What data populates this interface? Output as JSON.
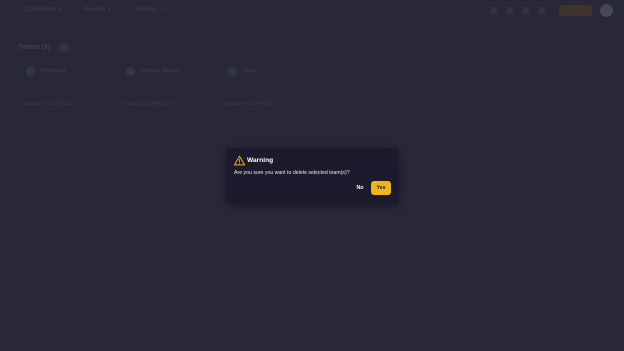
{
  "topbar": {
    "nav": [
      {
        "label": "Dashboard"
      },
      {
        "label": "Reports"
      },
      {
        "label": "Settings"
      }
    ]
  },
  "page": {
    "heading": "Teams (3)"
  },
  "teams": [
    {
      "name": "Marketing",
      "meta": "Created on 12/04/2023"
    },
    {
      "name": "Product Design",
      "meta": "Created on 18/04/2023"
    },
    {
      "name": "Sales",
      "meta": "Created on 21/04/2023"
    }
  ],
  "dialog": {
    "icon": "warning-triangle-icon",
    "title": "Warning",
    "message": "Are you sure you want to delete selected team(s)?",
    "no_label": "No",
    "yes_label": "Yes",
    "accent": "#f0b51d"
  }
}
